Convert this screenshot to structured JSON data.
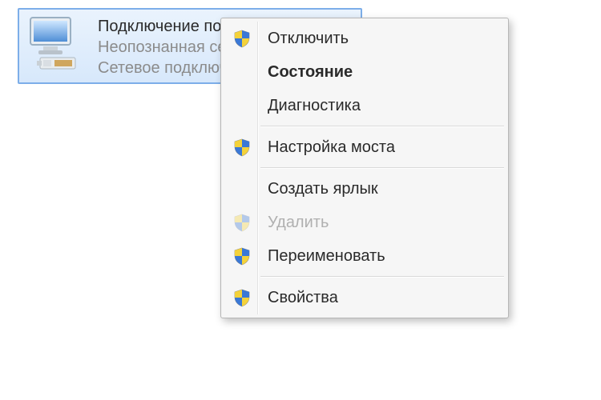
{
  "adapter": {
    "title": "Подключение по локальной сети",
    "status": "Неопознанная сеть",
    "device": "Сетевое подключени"
  },
  "context_menu": {
    "items": [
      {
        "label": "Отключить",
        "icon": "uac-shield",
        "bold": false,
        "disabled": false
      },
      {
        "label": "Состояние",
        "icon": "",
        "bold": true,
        "disabled": false
      },
      {
        "label": "Диагностика",
        "icon": "",
        "bold": false,
        "disabled": false
      },
      {
        "sep": true
      },
      {
        "label": "Настройка моста",
        "icon": "uac-shield",
        "bold": false,
        "disabled": false
      },
      {
        "sep": true
      },
      {
        "label": "Создать ярлык",
        "icon": "",
        "bold": false,
        "disabled": false
      },
      {
        "label": "Удалить",
        "icon": "uac-shield",
        "bold": false,
        "disabled": true
      },
      {
        "label": "Переименовать",
        "icon": "uac-shield",
        "bold": false,
        "disabled": false
      },
      {
        "sep": true
      },
      {
        "label": "Свойства",
        "icon": "uac-shield",
        "bold": false,
        "disabled": false
      }
    ]
  }
}
